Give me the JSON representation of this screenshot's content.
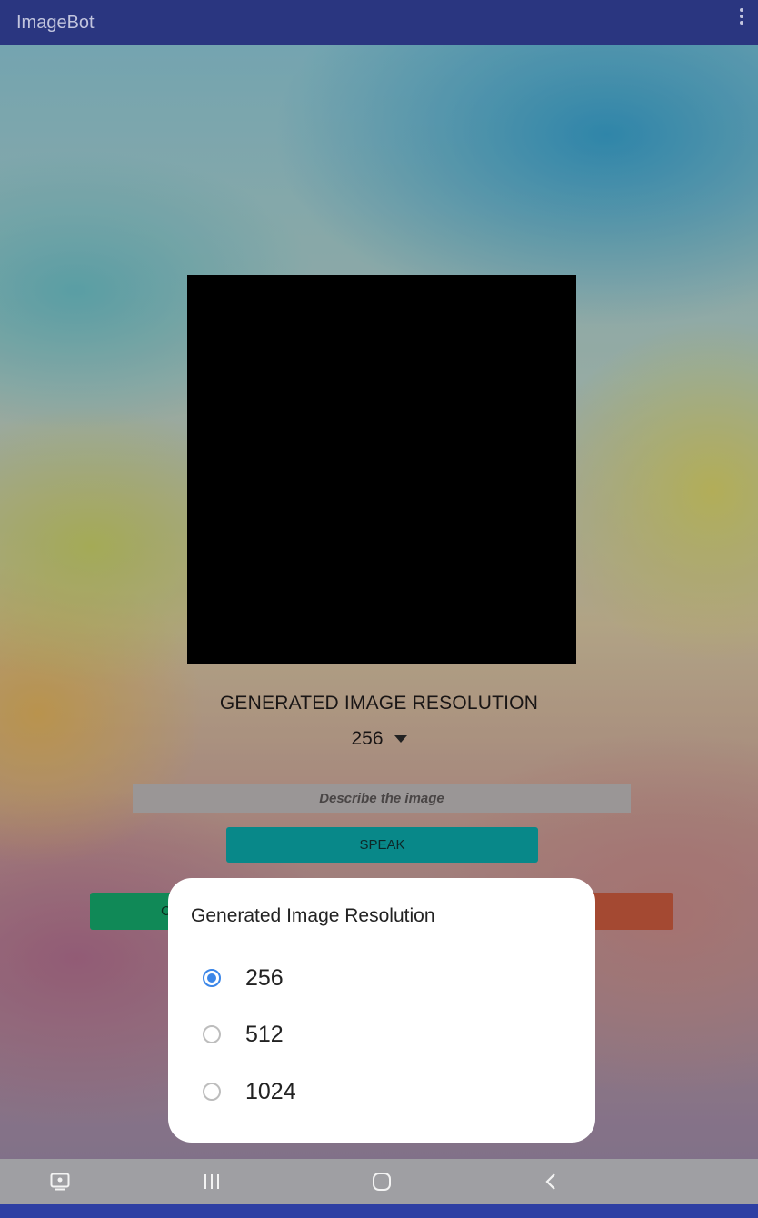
{
  "app": {
    "title": "ImageBot"
  },
  "main": {
    "resolution_heading": "GENERATED IMAGE RESOLUTION",
    "resolution_value": "256",
    "describe_placeholder": "Describe the image",
    "speak_label": "SPEAK",
    "green_button_label": "C"
  },
  "dialog": {
    "title": "Generated Image Resolution",
    "options": [
      {
        "label": "256",
        "selected": true
      },
      {
        "label": "512",
        "selected": false
      },
      {
        "label": "1024",
        "selected": false
      }
    ]
  },
  "navbar": {
    "icons": [
      "screenshot-icon",
      "recent-apps-icon",
      "home-icon",
      "back-icon"
    ]
  },
  "colors": {
    "appbar": "#2a3680",
    "speak": "#0aa6a8",
    "green": "#14a86b",
    "red": "#c85a3e",
    "radio_accent": "#3b86e8"
  }
}
